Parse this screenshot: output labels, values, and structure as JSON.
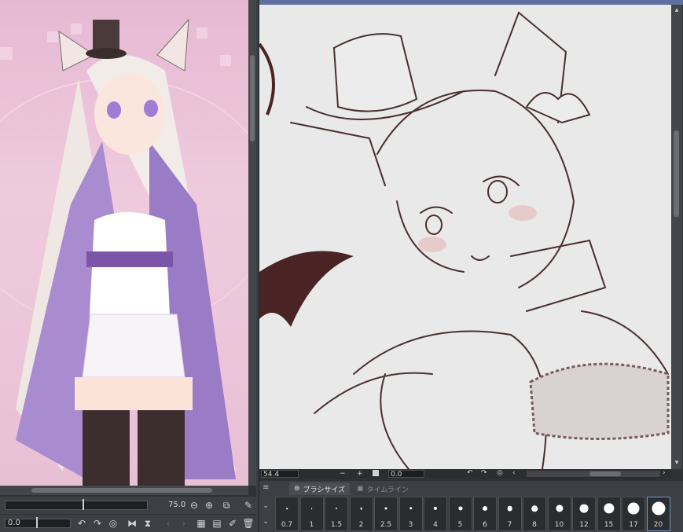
{
  "reference_panel": {
    "zoom_value": "75.0",
    "rotation_value": "0.0",
    "icons": [
      "zoom-out-icon",
      "zoom-in-icon",
      "fit-icon",
      "eyedropper-icon",
      "undo-icon",
      "redo-icon",
      "reset-icon",
      "flip-h-icon",
      "flip-v-icon",
      "prev-icon",
      "next-icon",
      "grid-icon",
      "open-folder-icon",
      "edit-icon",
      "trash-icon"
    ]
  },
  "canvas_status": {
    "zoom_value": "54.4",
    "angle_value": "0.0"
  },
  "brush_panel": {
    "tabs": [
      {
        "label": "ブラシサイズ",
        "active": true
      },
      {
        "label": "タイムライン",
        "active": false
      }
    ],
    "sizes": [
      "0.7",
      "1",
      "1.5",
      "2",
      "2.5",
      "3",
      "4",
      "5",
      "6",
      "7",
      "8",
      "10",
      "12",
      "15",
      "17",
      "20"
    ],
    "selected_size": "20"
  },
  "colors": {
    "ui_dark": "#2f3235",
    "ui_panel": "#3c3f43",
    "accent": "#6d9bd4"
  }
}
